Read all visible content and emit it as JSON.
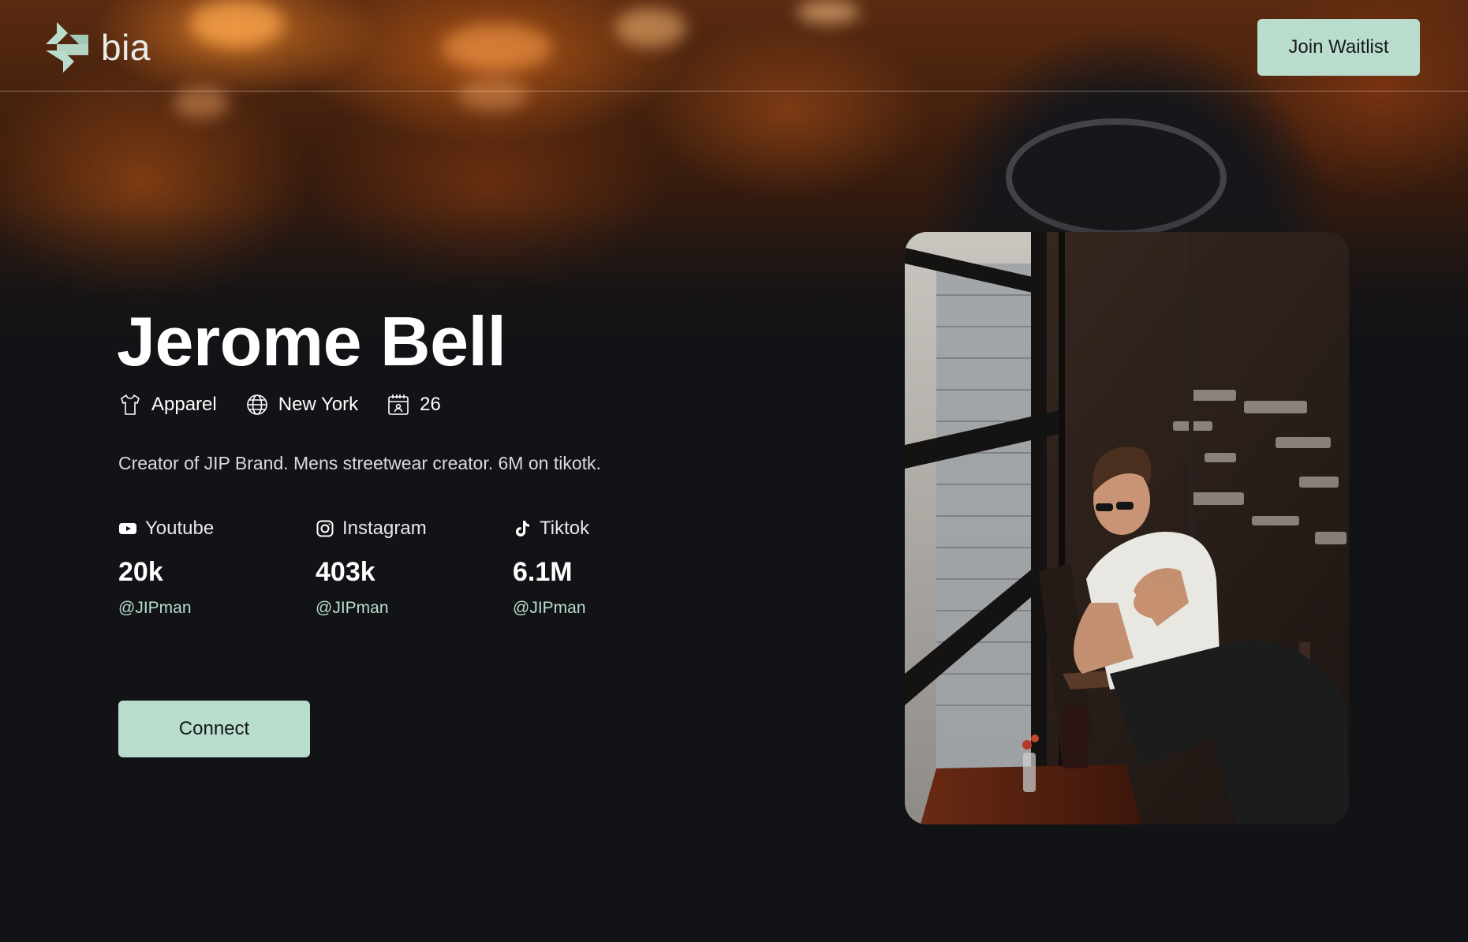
{
  "header": {
    "brand_name": "bia",
    "join_label": "Join Waitlist"
  },
  "profile": {
    "name": "Jerome Bell",
    "meta": {
      "category": "Apparel",
      "location": "New York",
      "age": "26"
    },
    "bio": "Creator of JIP Brand. Mens streetwear creator. 6M on tikotk.",
    "socials": [
      {
        "platform": "Youtube",
        "icon": "youtube-icon",
        "count": "20k",
        "handle": "@JIPman"
      },
      {
        "platform": "Instagram",
        "icon": "instagram-icon",
        "count": "403k",
        "handle": "@JIPman"
      },
      {
        "platform": "Tiktok",
        "icon": "tiktok-icon",
        "count": "6.1M",
        "handle": "@JIPman"
      }
    ],
    "connect_label": "Connect"
  },
  "colors": {
    "accent": "#b9dccd",
    "background": "#121316",
    "handle": "#b9dccd"
  },
  "icons": {
    "category": "shirt-icon",
    "location": "globe-icon",
    "age": "calendar-icon"
  }
}
